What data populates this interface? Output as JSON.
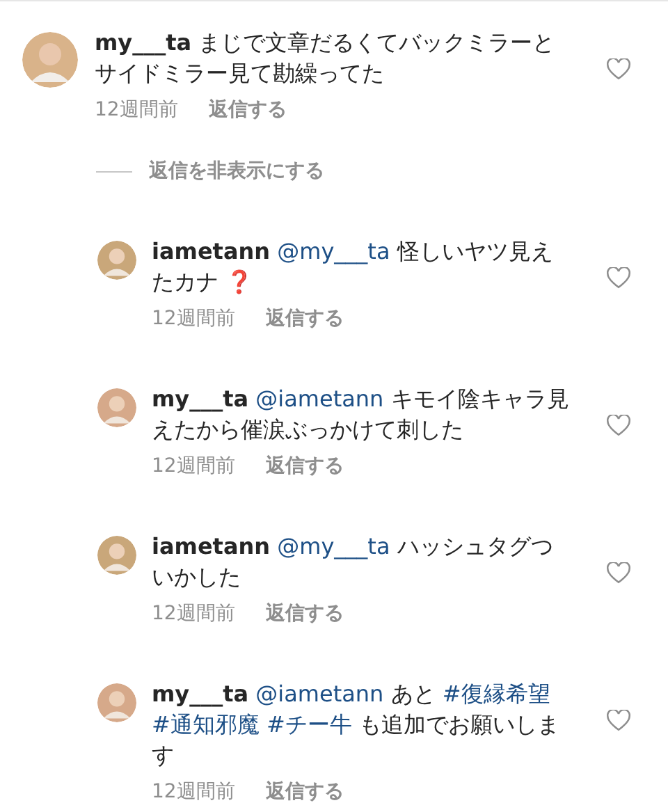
{
  "comment": {
    "author": "my___ta",
    "body": [
      {
        "kind": "text",
        "text": "まじで文章だるくてバックミラーとサイドミラー見て勘繰ってた"
      }
    ],
    "time": "12週間前",
    "reply": "返信する",
    "liked": false
  },
  "hide_replies": "返信を非表示にする",
  "replies": [
    {
      "author": "iametann",
      "body": [
        {
          "kind": "mention",
          "text": "@my___ta"
        },
        {
          "kind": "text",
          "text": "怪しいヤツ見えたカナ"
        },
        {
          "kind": "emoji",
          "text": "❓"
        }
      ],
      "time": "12週間前",
      "reply": "返信する",
      "liked": false
    },
    {
      "author": "my___ta",
      "body": [
        {
          "kind": "mention",
          "text": "@iametann"
        },
        {
          "kind": "text",
          "text": "キモイ陰キャラ見えたから催涙ぶっかけて刺した"
        }
      ],
      "time": "12週間前",
      "reply": "返信する",
      "liked": false
    },
    {
      "author": "iametann",
      "body": [
        {
          "kind": "mention",
          "text": "@my___ta"
        },
        {
          "kind": "text",
          "text": "ハッシュタグついかした"
        }
      ],
      "time": "12週間前",
      "reply": "返信する",
      "liked": false
    },
    {
      "author": "my___ta",
      "body": [
        {
          "kind": "mention",
          "text": "@iametann"
        },
        {
          "kind": "text",
          "text": "あと"
        },
        {
          "kind": "hashtag",
          "text": "#復縁希望"
        },
        {
          "kind": "hashtag",
          "text": "#通知邪魔"
        },
        {
          "kind": "hashtag",
          "text": "#チー牛"
        },
        {
          "kind": "text",
          "text": "も追加でお願いします"
        }
      ],
      "time": "12週間前",
      "reply": "返信する",
      "liked": false
    }
  ]
}
